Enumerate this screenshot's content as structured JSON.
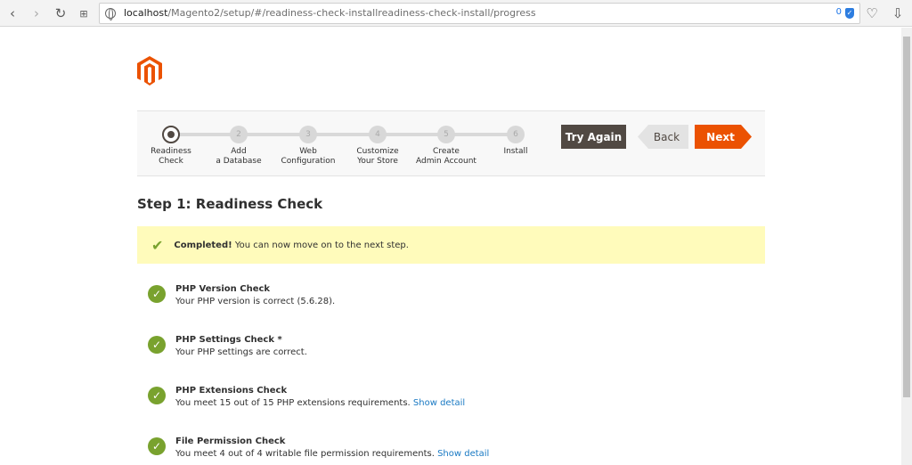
{
  "browser": {
    "url_host": "localhost",
    "url_path": "/Magento2/setup/#/readiness-check-installreadiness-check-install/progress",
    "shield_count": "0",
    "icons": [
      "back-icon",
      "forward-icon",
      "refresh-icon",
      "grid-icon",
      "globe-icon",
      "heart-icon",
      "download-icon"
    ]
  },
  "stepper": {
    "steps": [
      {
        "number": "",
        "label": "Readiness\nCheck"
      },
      {
        "number": "2",
        "label": "Add\na Database"
      },
      {
        "number": "3",
        "label": "Web\nConfiguration"
      },
      {
        "number": "4",
        "label": "Customize\nYour Store"
      },
      {
        "number": "5",
        "label": "Create\nAdmin Account"
      },
      {
        "number": "6",
        "label": "Install"
      }
    ]
  },
  "actions": {
    "try_again": "Try Again",
    "back": "Back",
    "next": "Next"
  },
  "main": {
    "title": "Step 1: Readiness Check",
    "notice_bold": "Completed!",
    "notice_text": " You can now move on to the next step.",
    "checks": [
      {
        "name": "PHP Version Check",
        "desc": "Your PHP version is correct (5.6.28).",
        "link": ""
      },
      {
        "name": "PHP Settings Check *",
        "desc": "Your PHP settings are correct.",
        "link": ""
      },
      {
        "name": "PHP Extensions Check",
        "desc": "You meet 15 out of 15 PHP extensions requirements. ",
        "link": "Show detail"
      },
      {
        "name": "File Permission Check",
        "desc": "You meet 4 out of 4 writable file permission requirements. ",
        "link": "Show detail"
      }
    ]
  },
  "colors": {
    "accent": "#eb5202",
    "success": "#79a22e",
    "dark": "#514943",
    "notice": "#fffbbb"
  }
}
